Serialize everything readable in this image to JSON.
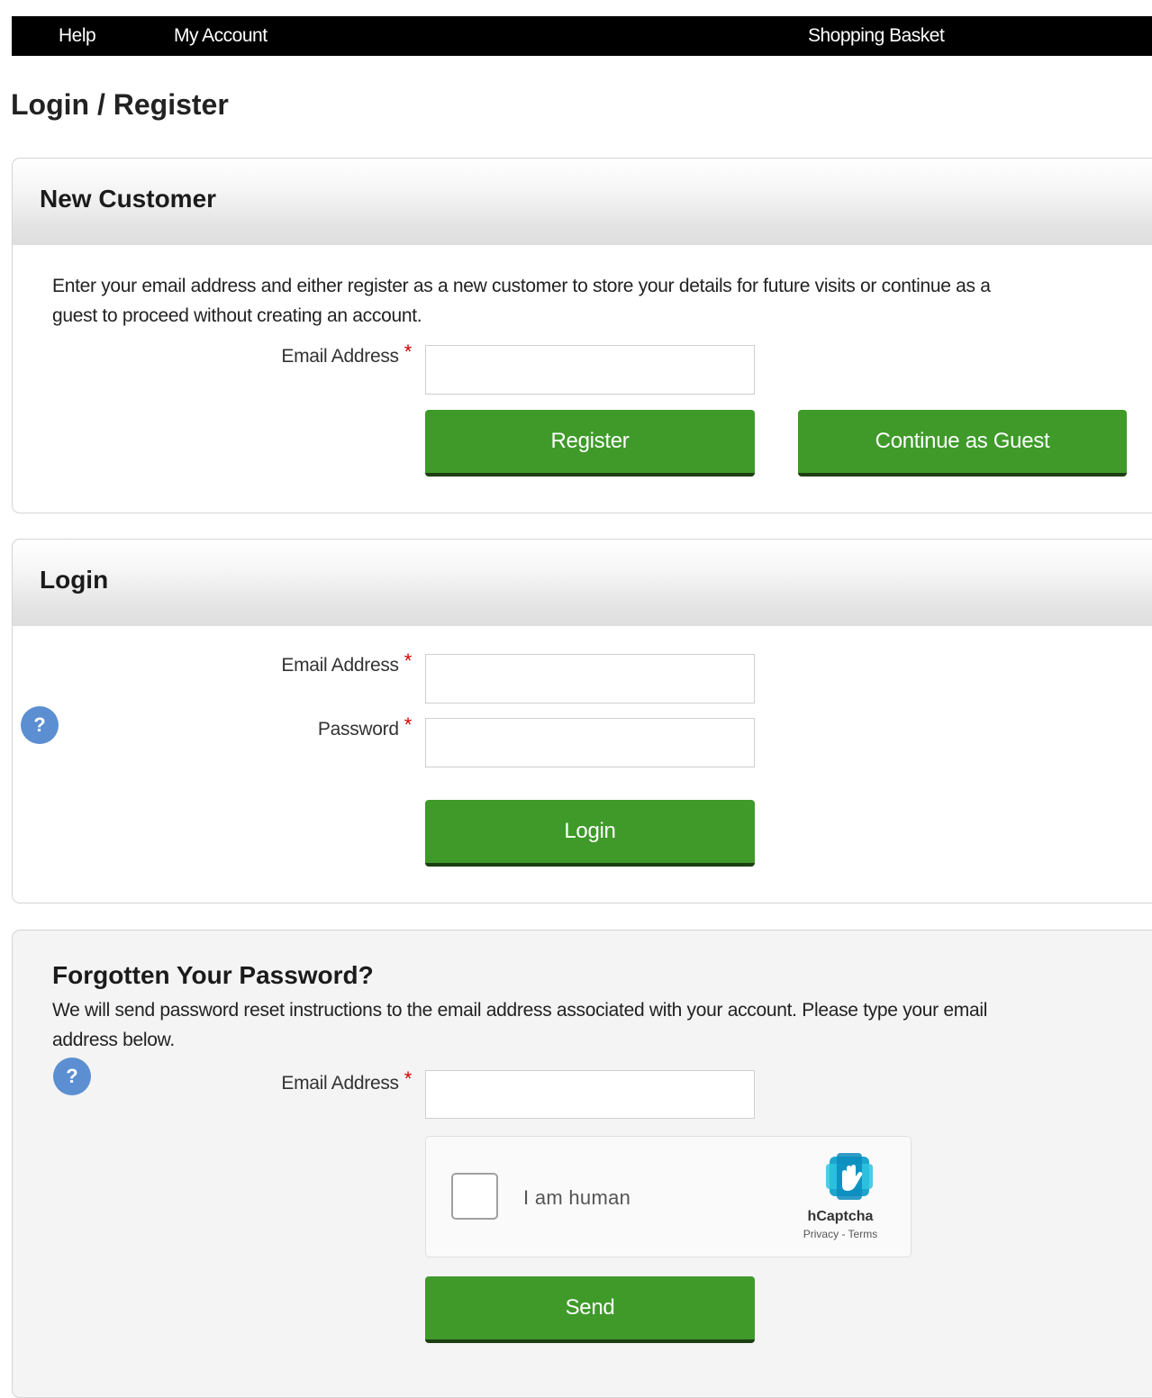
{
  "nav": {
    "help": "Help",
    "my_account": "My Account",
    "basket": "Shopping Basket"
  },
  "page_title": "Login / Register",
  "new_customer": {
    "title": "New Customer",
    "intro_line1": "Enter your email address and either register as a new customer to store your details for future visits or continue as a",
    "intro_line2": "guest to proceed without creating an account.",
    "email_label": "Email Address",
    "email_value": "",
    "register_label": "Register",
    "guest_label": "Continue as Guest"
  },
  "login": {
    "title": "Login",
    "email_label": "Email Address",
    "email_value": "",
    "password_label": "Password",
    "password_value": "",
    "login_label": "Login",
    "help_icon": "?"
  },
  "forgot": {
    "title": "Forgotten Your Password?",
    "intro_line1": "We will send password reset instructions to the email address associated with your account. Please type your email",
    "intro_line2": "address below.",
    "email_label": "Email Address",
    "email_value": "",
    "send_label": "Send",
    "help_icon": "?"
  },
  "captcha": {
    "text": "I am human",
    "brand": "hCaptcha",
    "links": "Privacy - Terms",
    "checked": false
  },
  "required_mark": "*",
  "colors": {
    "button_green": "#3f9a2a",
    "help_blue": "#5b8fd1",
    "required_red": "#d40000"
  }
}
